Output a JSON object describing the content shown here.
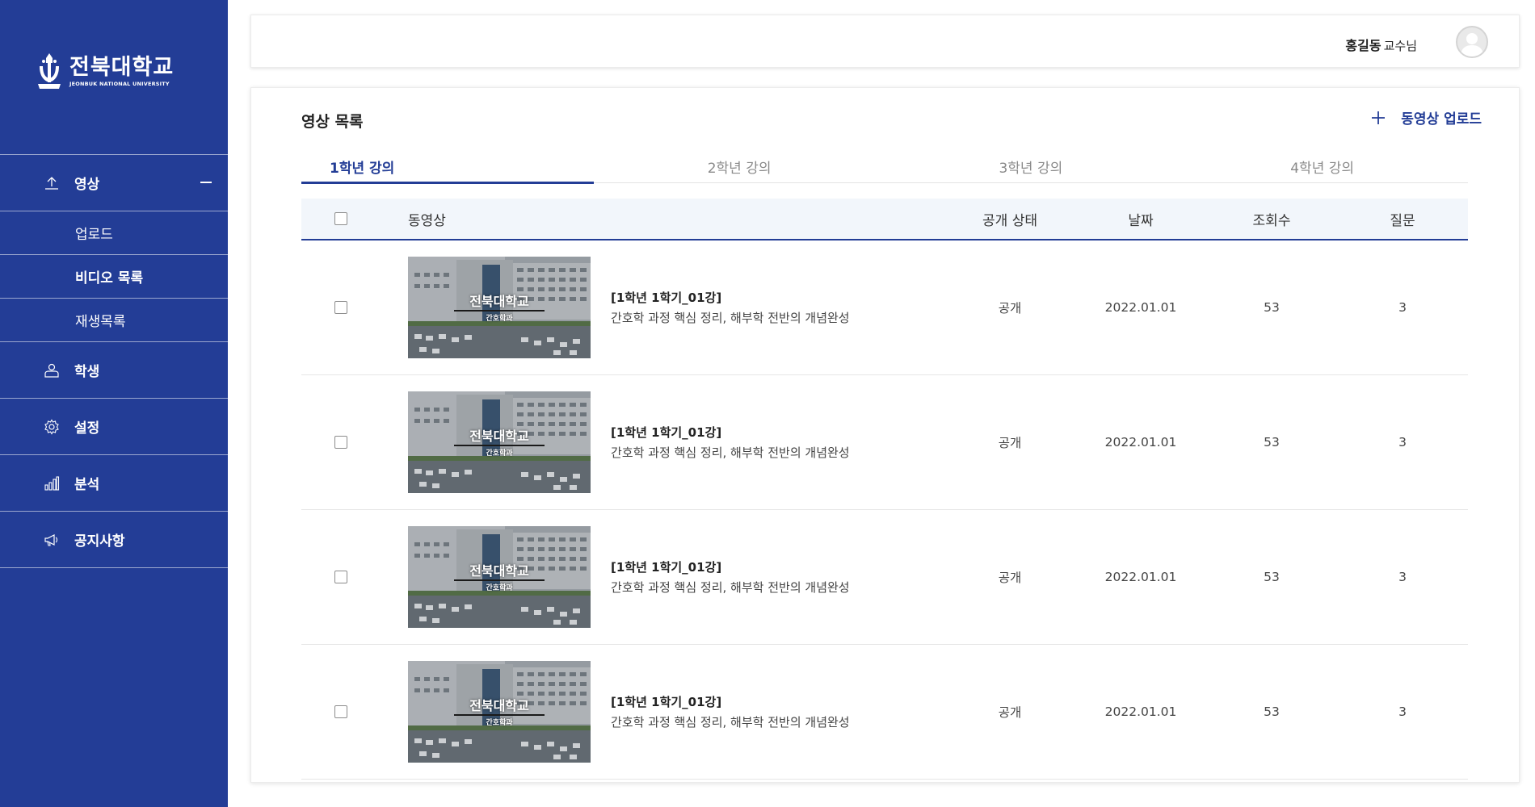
{
  "sidebar": {
    "logo_kr": "전북대학교",
    "logo_en": "JEONBUK NATIONAL UNIVERSITY",
    "menu": [
      {
        "label": "영상",
        "icon": "upload-icon"
      },
      {
        "label": "학생",
        "icon": "user-icon"
      },
      {
        "label": "설정",
        "icon": "gear-icon"
      },
      {
        "label": "분석",
        "icon": "bar-chart-icon"
      },
      {
        "label": "공지사항",
        "icon": "megaphone-icon"
      }
    ],
    "submenu": [
      "업로드",
      "비디오 목록",
      "재생목록"
    ]
  },
  "header": {
    "user_name": "홍길동",
    "user_title": "교수님"
  },
  "main": {
    "title": "영상 목록",
    "upload_label": "동영상 업로드",
    "tabs": [
      "1학년 강의",
      "2학년 강의",
      "3학년 강의",
      "4학년 강의"
    ],
    "table": {
      "headers": {
        "video": "동영상",
        "status": "공개 상태",
        "date": "날짜",
        "views": "조회수",
        "questions": "질문"
      },
      "rows": [
        {
          "thumb_title": "전북대학교",
          "thumb_sub": "간호학과",
          "title": "[1학년 1학기_01강]",
          "desc": "간호학 과정 핵심 정리, 해부학 전반의 개념완성",
          "status": "공개",
          "date": "2022.01.01",
          "views": "53",
          "questions": "3"
        },
        {
          "thumb_title": "전북대학교",
          "thumb_sub": "간호학과",
          "title": "[1학년 1학기_01강]",
          "desc": "간호학 과정 핵심 정리, 해부학 전반의 개념완성",
          "status": "공개",
          "date": "2022.01.01",
          "views": "53",
          "questions": "3"
        },
        {
          "thumb_title": "전북대학교",
          "thumb_sub": "간호학과",
          "title": "[1학년 1학기_01강]",
          "desc": "간호학 과정 핵심 정리, 해부학 전반의 개념완성",
          "status": "공개",
          "date": "2022.01.01",
          "views": "53",
          "questions": "3"
        },
        {
          "thumb_title": "전북대학교",
          "thumb_sub": "간호학과",
          "title": "[1학년 1학기_01강]",
          "desc": "간호학 과정 핵심 정리, 해부학 전반의 개념완성",
          "status": "공개",
          "date": "2022.01.01",
          "views": "53",
          "questions": "3"
        }
      ]
    }
  },
  "colors": {
    "brand": "#233d96",
    "header_bg": "#f2f6fb"
  }
}
